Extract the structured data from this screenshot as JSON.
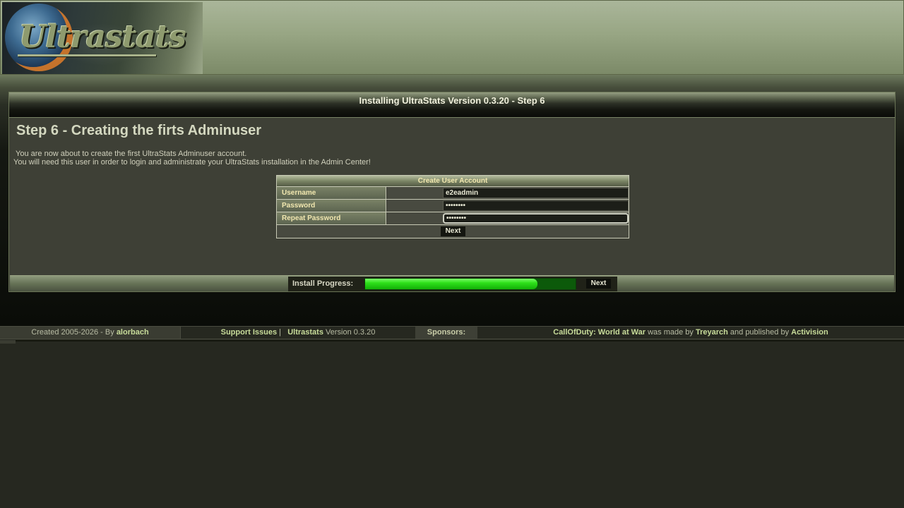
{
  "header": {
    "logo_text": "Ultrastats"
  },
  "panel": {
    "title": "Installing UltraStats Version 0.3.20 - Step 6",
    "heading": "Step 6 - Creating the firts Adminuser",
    "intro_line1": "You are now about to create the first UltraStats Adminuser account.",
    "intro_line2": "You will need this user in order to login and administrate your UltraStats installation in the Admin Center!"
  },
  "form": {
    "title": "Create User Account",
    "rows": [
      {
        "label": "Username",
        "value": "e2eadmin",
        "type": "text"
      },
      {
        "label": "Password",
        "value": "••••••••",
        "type": "password"
      },
      {
        "label": "Repeat Password",
        "value": "••••••••",
        "type": "password"
      }
    ],
    "submit_label": "Next"
  },
  "progress": {
    "label": "Install Progress:",
    "percent": 82,
    "next_label": "Next"
  },
  "footer": {
    "created_prefix": "Created 2005-2026 - By",
    "author": "alorbach",
    "support_link": "Support Issues",
    "separator": "|",
    "product_link": "Ultrastats",
    "version_text": "Version 0.3.20",
    "sponsors_label": "Sponsors:",
    "game_link": "CallOfDuty: World at War",
    "made_by_text": "was made by",
    "developer_link": "Treyarch",
    "published_text": "and published by",
    "publisher_link": "Activision"
  },
  "colors": {
    "accent_text": "#f2e8b0",
    "link": "#c8dc9a",
    "progress_fill": "#2ee01a"
  }
}
